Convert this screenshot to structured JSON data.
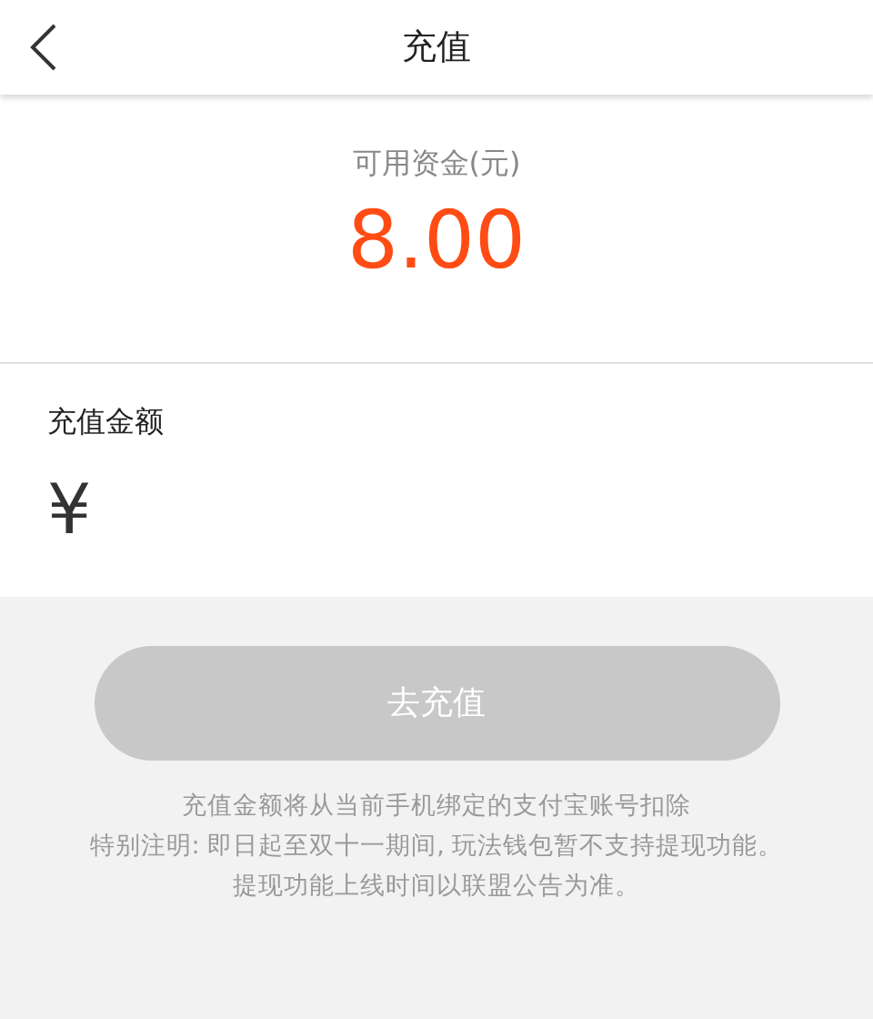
{
  "header": {
    "title": "充值"
  },
  "balance": {
    "label": "可用资金(元)",
    "amount": "8.00"
  },
  "recharge": {
    "label": "充值金额",
    "currency": "¥"
  },
  "submit": {
    "label": "去充值",
    "disabled": true
  },
  "notes": [
    "充值金额将从当前手机绑定的支付宝账号扣除",
    "特别注明: 即日起至双十一期间, 玩法钱包暂不支持提现功能。",
    "提现功能上线时间以联盟公告为准。"
  ]
}
